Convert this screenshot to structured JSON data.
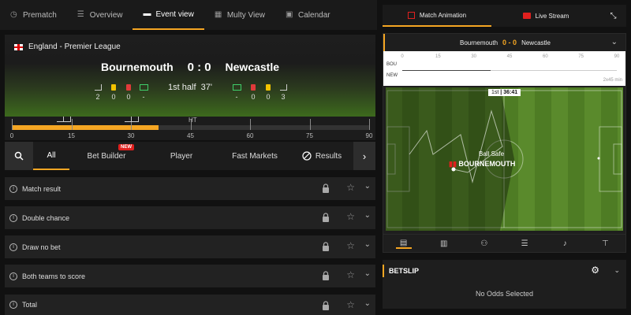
{
  "nav": {
    "items": [
      {
        "label": "Prematch",
        "icon": "clock-icon"
      },
      {
        "label": "Overview",
        "icon": "list-icon"
      },
      {
        "label": "Event view",
        "icon": "bar-icon"
      },
      {
        "label": "Multy View",
        "icon": "grid-icon"
      },
      {
        "label": "Calendar",
        "icon": "calendar-icon"
      }
    ],
    "active": "Event view"
  },
  "match": {
    "league": "England - Premier League",
    "home": "Bournemouth",
    "away": "Newcastle",
    "score": "0 : 0",
    "period": "1st half",
    "minute": "37'",
    "home_stats": [
      "2",
      "0",
      "0",
      "-"
    ],
    "away_stats": [
      "-",
      "0",
      "0",
      "3"
    ]
  },
  "timeline": {
    "ticks": [
      "0",
      "15",
      "30",
      "45",
      "60",
      "75",
      "90"
    ],
    "ht_label": "HT",
    "progress_minute": 37
  },
  "tabs": {
    "items": [
      "All",
      "Bet Builder",
      "Player",
      "Fast Markets",
      "Results"
    ],
    "new_badge": "NEW",
    "active": "All"
  },
  "markets": [
    {
      "name": "Match result"
    },
    {
      "name": "Double chance"
    },
    {
      "name": "Draw no bet"
    },
    {
      "name": "Both teams to score"
    },
    {
      "name": "Total"
    }
  ],
  "right": {
    "tabs": [
      "Match Animation",
      "Live Stream"
    ],
    "panel_home": "Bournemouth",
    "panel_score": "0 - 0",
    "panel_away": "Newcastle",
    "mini_home": "BOU",
    "mini_away": "NEW",
    "mini_scale": [
      "0",
      "15",
      "30",
      "45",
      "60",
      "75",
      "90"
    ],
    "mini_duration": "2x45 min",
    "clock_half": "1st",
    "clock_time": "36:41",
    "ball_status": "Ball Safe",
    "ball_team": "BOURNEMOUTH"
  },
  "betslip": {
    "title": "BETSLIP",
    "empty": "No Odds Selected"
  },
  "colors": {
    "accent": "#f5a623",
    "red": "#e0201e",
    "pitch": "#5a8a2c"
  }
}
